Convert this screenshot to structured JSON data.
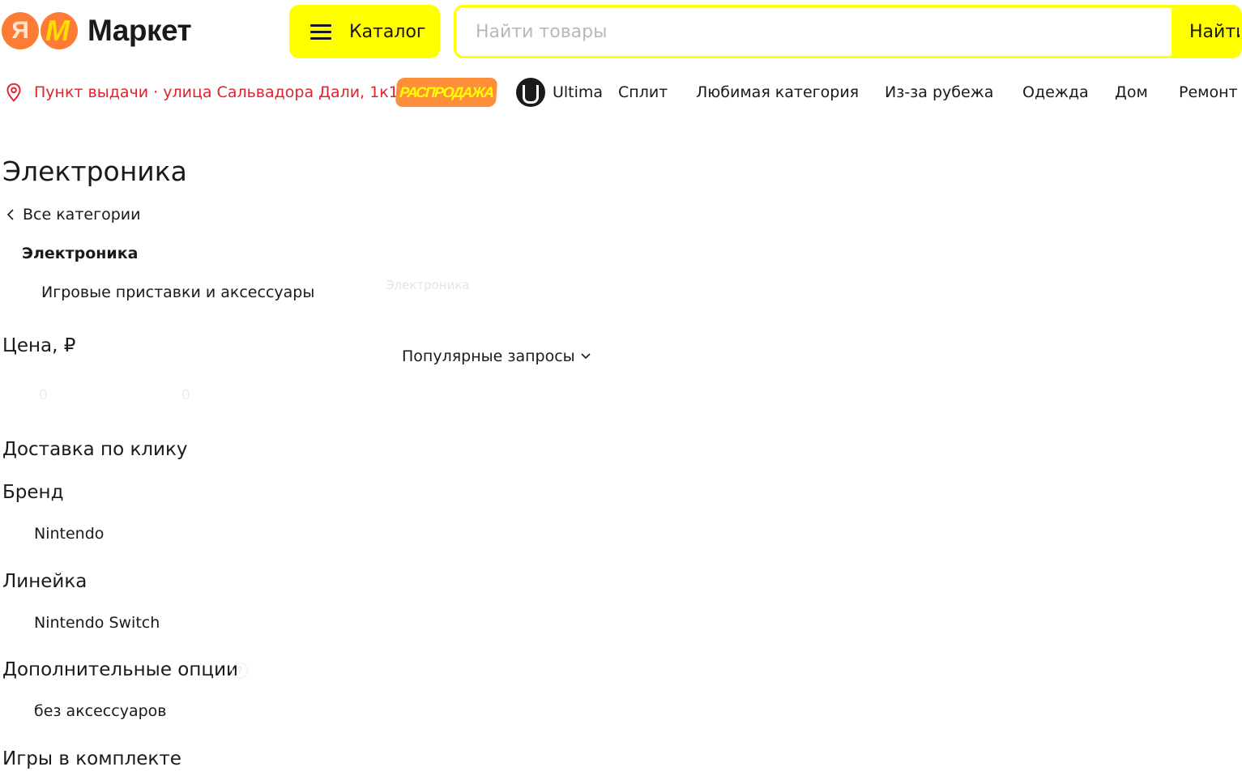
{
  "header": {
    "logo_letter": "Я",
    "logo_text": "Маркет",
    "catalog_label": "Каталог",
    "search_placeholder": "Найти товары",
    "search_button": "Найти"
  },
  "nav": {
    "pickup": "Пункт выдачи · улица Сальвадора Дали, 1к1",
    "sale_badge": "РАСПРОДАЖА",
    "links": [
      "Ultima",
      "Сплит",
      "Любимая категория",
      "Из-за рубежа",
      "Одежда",
      "Дом",
      "Ремонт"
    ]
  },
  "sidebar": {
    "title": "Электроника",
    "all_categories": "Все категории",
    "current_category": "Электроника",
    "subcategory": "Игровые приставки и аксессуары",
    "filters": {
      "price_title": "Цена, ₽",
      "price_from_placeholder": "0",
      "price_to_placeholder": "0",
      "delivery_title": "Доставка по клику",
      "brand_title": "Бренд",
      "brand_option": "Nintendo",
      "line_title": "Линейка",
      "line_option": "Nintendo Switch",
      "options_title": "Дополнительные опции",
      "options_help": "?",
      "options_option": "без аксессуаров",
      "games_title": "Игры в комплекте"
    }
  },
  "content": {
    "breadcrumb_faint": "Электроника",
    "popular_queries": "Популярные запросы"
  },
  "colors": {
    "brand_yellow": "#ffff00",
    "brand_orange": "#fc7c36",
    "pickup_red": "#e0232e"
  }
}
